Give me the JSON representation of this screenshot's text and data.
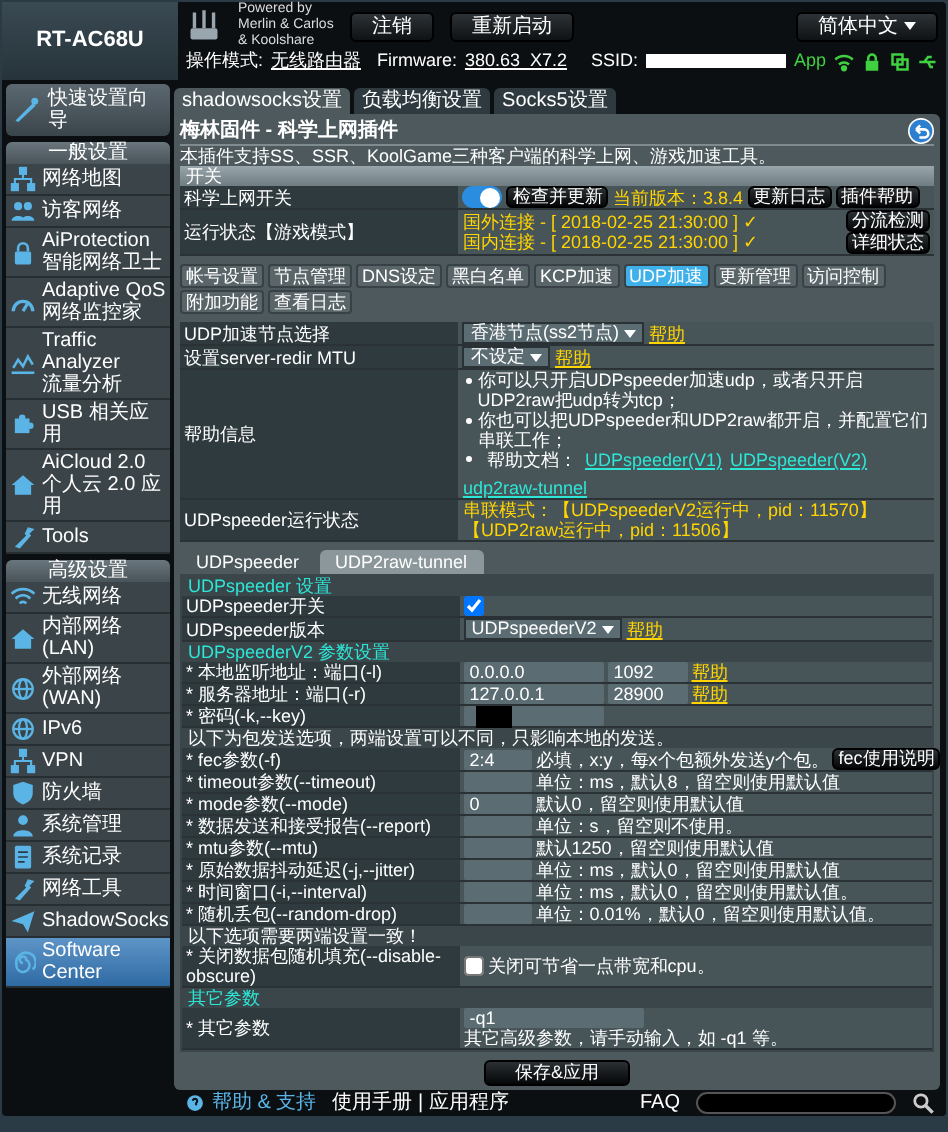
{
  "header": {
    "model": "RT-AC68U",
    "powered_by": [
      "Powered by",
      "Merlin & Carlos",
      "& Koolshare"
    ],
    "buttons": [
      "注销",
      "重新启动"
    ],
    "language": "简体中文",
    "mode_label": "操作模式:",
    "mode": "无线路由器",
    "firmware_label": "Firmware:",
    "firmware": "380.63_X7.2",
    "ssid_label": "SSID:",
    "app_label": "App"
  },
  "sidebar": {
    "quick_setup": "快速设置向导",
    "sections": [
      {
        "title": "一般设置",
        "items": [
          {
            "label": "网络地图",
            "selected": false
          },
          {
            "label": "访客网络",
            "selected": false
          },
          {
            "label": "AiProtection",
            "sublabel": "智能网络卫士",
            "selected": false
          },
          {
            "label": "Adaptive QoS",
            "sublabel": "网络监控家",
            "selected": false
          },
          {
            "label": "Traffic Analyzer",
            "sublabel": "流量分析",
            "selected": false
          },
          {
            "label": "USB 相关应用",
            "selected": false
          },
          {
            "label": "AiCloud 2.0",
            "sublabel": "个人云 2.0 应用",
            "selected": false
          },
          {
            "label": "Tools",
            "selected": false
          }
        ]
      },
      {
        "title": "高级设置",
        "items": [
          {
            "label": "无线网络",
            "selected": false
          },
          {
            "label": "内部网络(LAN)",
            "selected": false
          },
          {
            "label": "外部网络(WAN)",
            "selected": false
          },
          {
            "label": "IPv6",
            "selected": false
          },
          {
            "label": "VPN",
            "selected": false
          },
          {
            "label": "防火墙",
            "selected": false
          },
          {
            "label": "系统管理",
            "selected": false
          },
          {
            "label": "系统记录",
            "selected": false
          },
          {
            "label": "网络工具",
            "selected": false
          },
          {
            "label": "ShadowSocks",
            "selected": false
          },
          {
            "label": "Software Center",
            "selected": true
          }
        ]
      }
    ]
  },
  "top_tabs": [
    {
      "label": "shadowsocks设置",
      "selected": true
    },
    {
      "label": "负载均衡设置",
      "selected": false
    },
    {
      "label": "Socks5设置",
      "selected": false
    }
  ],
  "panel": {
    "title": "梅林固件 - 科学上网插件",
    "description": "本插件支持SS、SSR、KoolGame三种客户端的科学上网、游戏加速工具。",
    "section": "开关",
    "switch_row": {
      "label": "科学上网开关",
      "on": true,
      "check_button": "检查并更新",
      "version": "当前版本：3.8.4",
      "buttons": [
        "更新日志",
        "插件帮助"
      ]
    },
    "status_row": {
      "label": "运行状态【游戏模式】",
      "lines": [
        "国外连接 - [ 2018-02-25 21:30:00 ] ✓",
        "国内连接 - [ 2018-02-25 21:30:00 ] ✓"
      ],
      "buttons": [
        "分流检测",
        "详细状态"
      ]
    },
    "sub_tabs": [
      {
        "label": "帐号设置",
        "selected": false
      },
      {
        "label": "节点管理",
        "selected": false
      },
      {
        "label": "DNS设定",
        "selected": false
      },
      {
        "label": "黑白名单",
        "selected": false
      },
      {
        "label": "KCP加速",
        "selected": false
      },
      {
        "label": "UDP加速",
        "selected": true
      },
      {
        "label": "更新管理",
        "selected": false
      },
      {
        "label": "访问控制",
        "selected": false
      },
      {
        "label": "附加功能",
        "selected": false
      },
      {
        "label": "查看日志",
        "selected": false
      }
    ],
    "settings_rows": [
      {
        "kind": "select",
        "label": "UDP加速节点选择",
        "value": "香港节点(ss2节点)",
        "help": "帮助"
      },
      {
        "kind": "select",
        "label": "设置server-redir MTU",
        "value": "不设定",
        "help": "帮助"
      },
      {
        "kind": "bullets",
        "label": "帮助信息",
        "items": [
          "你可以只开启UDPspeeder加速udp，或者只开启UDP2raw把udp转为tcp；",
          "你也可以把UDPspeeder和UDP2raw都开启，并配置它们串联工作；"
        ],
        "links_label": "帮助文档：",
        "links": [
          "UDPspeeder(V1)",
          "UDPspeeder(V2)",
          "udp2raw-tunnel"
        ]
      },
      {
        "kind": "status",
        "label": "UDPspeeder运行状态",
        "text": "串联模式：【UDPspeederV2运行中，pid：11570】【UDP2raw运行中，pid：11506】"
      }
    ],
    "inner_tabs": [
      {
        "label": "UDPspeeder",
        "selected": true
      },
      {
        "label": "UDP2raw-tunnel",
        "selected": false
      }
    ],
    "udp_rows": [
      {
        "kind": "section",
        "label": "UDPspeeder 设置"
      },
      {
        "kind": "checkbox",
        "label": "UDPspeeder开关",
        "checked": true
      },
      {
        "kind": "select",
        "label": "UDPspeeder版本",
        "value": "UDPspeederV2",
        "help": "帮助"
      },
      {
        "kind": "section",
        "label": "UDPspeederV2 参数设置"
      },
      {
        "kind": "hostport",
        "label": "* 本地监听地址：端口(-l)",
        "host": "0.0.0.0",
        "port": "1092",
        "help": "帮助"
      },
      {
        "kind": "hostport",
        "label": "* 服务器地址：端口(-r)",
        "host": "127.0.0.1",
        "port": "28900",
        "help": "帮助"
      },
      {
        "kind": "password",
        "label": "* 密码(-k,--key)"
      },
      {
        "kind": "note",
        "label": "以下为包发送选项，两端设置可以不同，只影响本地的发送。"
      },
      {
        "kind": "input",
        "label": "* fec参数(-f)",
        "value": "2:4",
        "hint": "必填，x:y，每x个包额外发送y个包。",
        "button": "fec使用说明"
      },
      {
        "kind": "input",
        "label": "* timeout参数(--timeout)",
        "hint": "单位：ms，默认8，留空则使用默认值"
      },
      {
        "kind": "input",
        "label": "* mode参数(--mode)",
        "value": "0",
        "hint": "默认0，留空则使用默认值"
      },
      {
        "kind": "input",
        "label": "* 数据发送和接受报告(--report)",
        "hint": "单位：s，留空则不使用。"
      },
      {
        "kind": "input",
        "label": "* mtu参数(--mtu)",
        "hint": "默认1250，留空则使用默认值"
      },
      {
        "kind": "input",
        "label": "* 原始数据抖动延迟(-j,--jitter)",
        "hint": "单位：ms，默认0，留空则使用默认值"
      },
      {
        "kind": "input",
        "label": "* 时间窗口(-i,--interval)",
        "hint": "单位：ms，默认0，留空则使用默认值。"
      },
      {
        "kind": "input",
        "label": "* 随机丢包(--random-drop)",
        "hint": "单位：0.01%，默认0，留空则使用默认值。"
      },
      {
        "kind": "note",
        "label": "以下选项需要两端设置一致！"
      },
      {
        "kind": "checkbox",
        "label": "* 关闭数据包随机填充(--disable-obscure)",
        "checked": false,
        "hint": "关闭可节省一点带宽和cpu。"
      },
      {
        "kind": "section",
        "label": "其它参数"
      },
      {
        "kind": "stack",
        "label": "* 其它参数",
        "value": "-q1",
        "hint": "其它高级参数，请手动输入，如 -q1 等。"
      }
    ],
    "save_button": "保存&应用"
  },
  "footer": {
    "help_link": "帮助 & 支持",
    "manual": "使用手册 | 应用程序",
    "faq_label": "FAQ"
  }
}
